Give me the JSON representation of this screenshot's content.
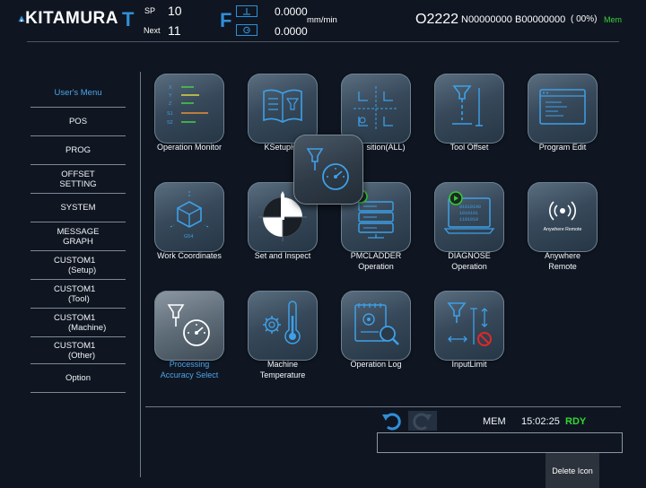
{
  "header": {
    "brand": "KITAMURA",
    "tool_letter": "T",
    "sp_label": "SP",
    "sp_value": "10",
    "next_label": "Next",
    "next_value": "11",
    "feed_letter": "F",
    "feed_value_1": "0.0000",
    "feed_value_2": "0.0000",
    "feed_unit": "mm/min",
    "program_number": "O2222",
    "n_number": "N00000000",
    "b_number": "B00000000",
    "percent": "( 00%)",
    "mode": "Mem",
    "colors": {
      "accent": "#2f8fd8",
      "mode": "#3ad13a"
    }
  },
  "sidebar": {
    "items": [
      {
        "label": "User's Menu",
        "active": true
      },
      {
        "label": "POS"
      },
      {
        "label": "PROG"
      },
      {
        "label": "OFFSET",
        "label2": "SETTING"
      },
      {
        "label": "SYSTEM"
      },
      {
        "label": "MESSAGE",
        "label2": "GRAPH"
      },
      {
        "label": "CUSTOM1",
        "label2": "(Setup)"
      },
      {
        "label": "CUSTOM1",
        "label2": "(Tool)"
      },
      {
        "label": "CUSTOM1",
        "label2": "(Machine)"
      },
      {
        "label": "CUSTOM1",
        "label2": "(Other)"
      },
      {
        "label": "Option"
      }
    ]
  },
  "tiles": [
    {
      "label": "Operation Monitor",
      "icon": "operation-monitor-icon",
      "label2": ""
    },
    {
      "label": "KSetupHe",
      "icon": "ksetup-help-icon",
      "label2": ""
    },
    {
      "label": "sition(ALL)",
      "icon": "position-all-icon",
      "label2": ""
    },
    {
      "label": "Tool   Offset",
      "icon": "tool-offset-icon",
      "label2": ""
    },
    {
      "label": "Program Edit",
      "icon": "program-edit-icon",
      "label2": ""
    },
    {
      "label": "Work Coordinates",
      "icon": "work-coordinates-icon",
      "label2": "",
      "badge": "G54"
    },
    {
      "label": "Set and Inspect",
      "icon": "set-and-inspect-icon",
      "label2": ""
    },
    {
      "label": "PMCLADDER",
      "icon": "pmcladder-icon",
      "label2": "Operation"
    },
    {
      "label": "DIAGNOSE",
      "icon": "diagnose-icon",
      "label2": "Operation"
    },
    {
      "label": "Anywhere",
      "icon": "anywhere-remote-icon",
      "label2": "Remote",
      "badge": "Anywhere Remote"
    },
    {
      "label": "Processing",
      "icon": "processing-accuracy-icon",
      "label2": "Accuracy Select",
      "selected": true
    },
    {
      "label": "Machine",
      "icon": "machine-temperature-icon",
      "label2": "Temperature"
    },
    {
      "label": "Operation Log",
      "icon": "operation-log-icon",
      "label2": ""
    },
    {
      "label": "InputLimit",
      "icon": "input-limit-icon",
      "label2": ""
    }
  ],
  "monitor_axes": [
    "X",
    "Y",
    "Z",
    "S1",
    "S2"
  ],
  "dragging_tile": {
    "icon": "processing-accuracy-icon"
  },
  "status": {
    "undo_icon": "undo-icon",
    "redo_icon": "redo-icon",
    "mode": "MEM",
    "time": "15:02:25",
    "state": "RDY",
    "state_color": "#33d833"
  },
  "command_input": {
    "value": ""
  },
  "delete_button": {
    "label": "Delete Icon"
  }
}
